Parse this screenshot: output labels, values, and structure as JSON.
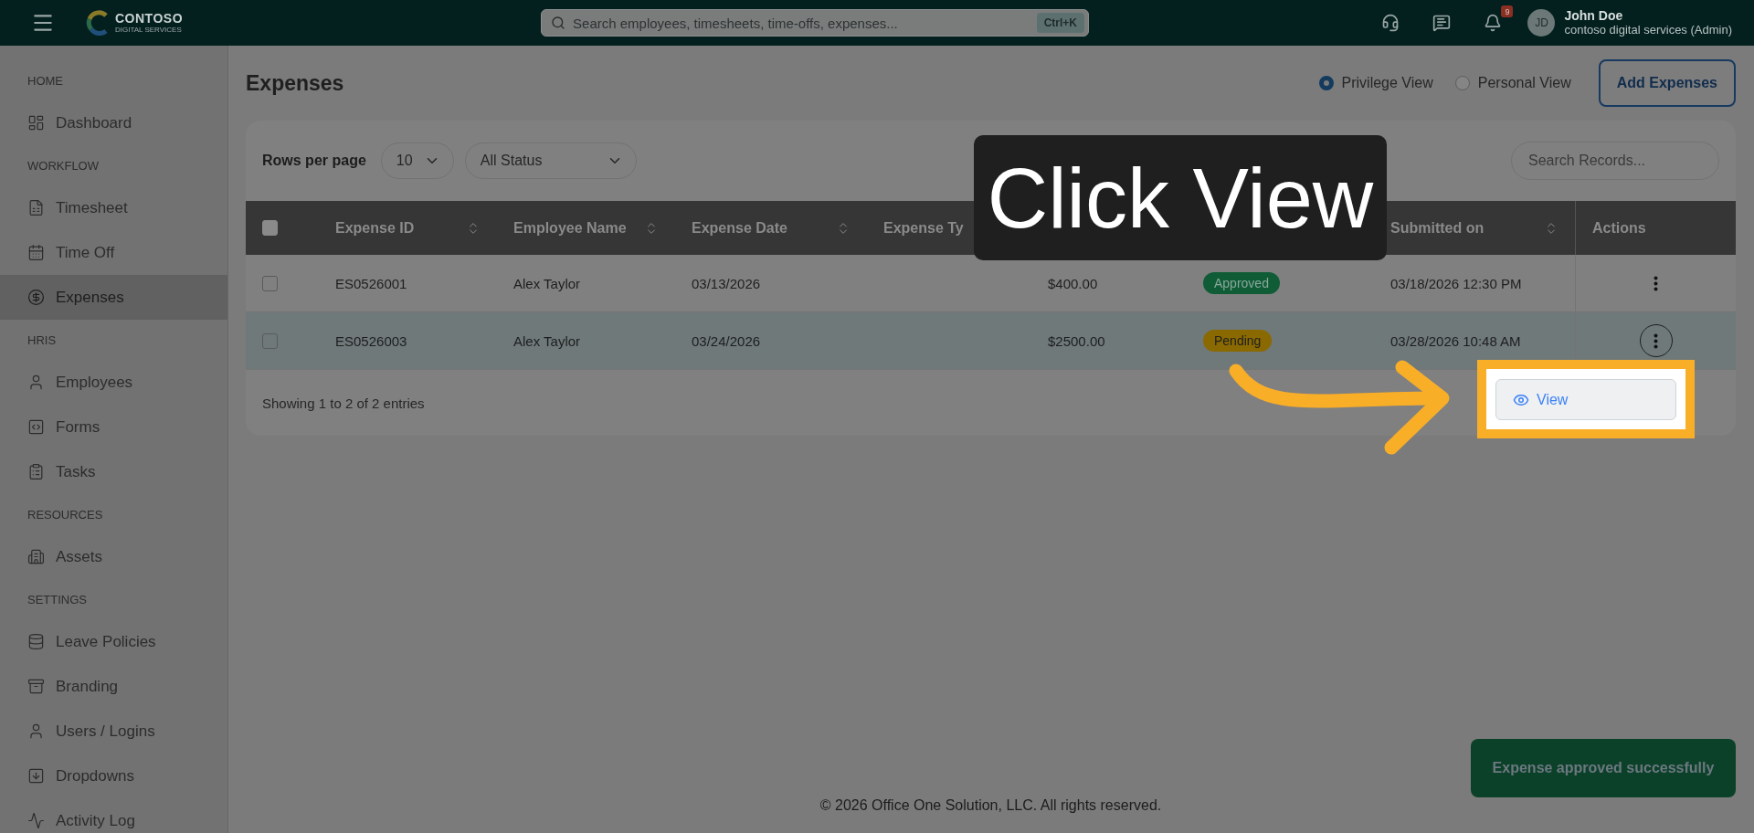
{
  "top_bar": {
    "logo": {
      "name": "CONTOSO",
      "tagline": "DIGITAL SERVICES"
    },
    "search": {
      "placeholder": "Search employees, timesheets, time-offs, expenses...",
      "shortcut": "Ctrl+K"
    },
    "notifications_count": "9",
    "user": {
      "initials": "JD",
      "name": "John Doe",
      "org": "contoso digital services (Admin)"
    }
  },
  "sidebar": {
    "sections": [
      {
        "label": "HOME",
        "items": [
          {
            "label": "Dashboard",
            "selected": false
          }
        ]
      },
      {
        "label": "WORKFLOW",
        "items": [
          {
            "label": "Timesheet",
            "selected": false
          },
          {
            "label": "Time Off",
            "selected": false
          },
          {
            "label": "Expenses",
            "selected": true
          }
        ]
      },
      {
        "label": "HRIS",
        "items": [
          {
            "label": "Employees",
            "selected": false
          },
          {
            "label": "Forms",
            "selected": false
          },
          {
            "label": "Tasks",
            "selected": false
          }
        ]
      },
      {
        "label": "RESOURCES",
        "items": [
          {
            "label": "Assets",
            "selected": false
          }
        ]
      },
      {
        "label": "SETTINGS",
        "items": [
          {
            "label": "Leave Policies",
            "selected": false
          },
          {
            "label": "Branding",
            "selected": false
          },
          {
            "label": "Users / Logins",
            "selected": false
          },
          {
            "label": "Dropdowns",
            "selected": false
          },
          {
            "label": "Activity Log",
            "selected": false
          }
        ]
      }
    ]
  },
  "page": {
    "title": "Expenses",
    "view_options": [
      {
        "label": "Privilege View",
        "selected": true
      },
      {
        "label": "Personal View",
        "selected": false
      }
    ],
    "add_button": "Add Expenses"
  },
  "table_controls": {
    "rows_label": "Rows per page",
    "rows_per_page": "10",
    "status_filter": "All Status",
    "search_placeholder": "Search Records..."
  },
  "table": {
    "select_all_checked": false,
    "columns": [
      {
        "label": "Expense ID",
        "sortable": true
      },
      {
        "label": "Employee Name",
        "sortable": true
      },
      {
        "label": "Expense Date",
        "sortable": true
      },
      {
        "label": "Expense Ty",
        "sortable": false
      },
      {},
      {},
      {
        "label": "Submitted on",
        "sortable": true
      },
      {
        "label": "Actions",
        "sortable": false
      }
    ],
    "rows": [
      {
        "id": "ES0526001",
        "employee": "Alex Taylor",
        "date": "03/13/2026",
        "amount": "$400.00",
        "status": {
          "label": "Approved",
          "kind": "approved"
        },
        "submitted": "03/18/2026 12:30 PM",
        "checked": false,
        "selected": false,
        "menu_open": false
      },
      {
        "id": "ES0526003",
        "employee": "Alex Taylor",
        "date": "03/24/2026",
        "amount": "$2500.00",
        "status": {
          "label": "Pending",
          "kind": "pending"
        },
        "submitted": "03/28/2026 10:48 AM",
        "checked": false,
        "selected": true,
        "menu_open": true
      }
    ],
    "footer": "Showing 1 to 2 of 2 entries"
  },
  "row_menu": {
    "items": [
      "View"
    ]
  },
  "callout": "Click View",
  "toast": "Expense approved successfully",
  "footer": "© 2026 Office One Solution, LLC. All rights reserved."
}
